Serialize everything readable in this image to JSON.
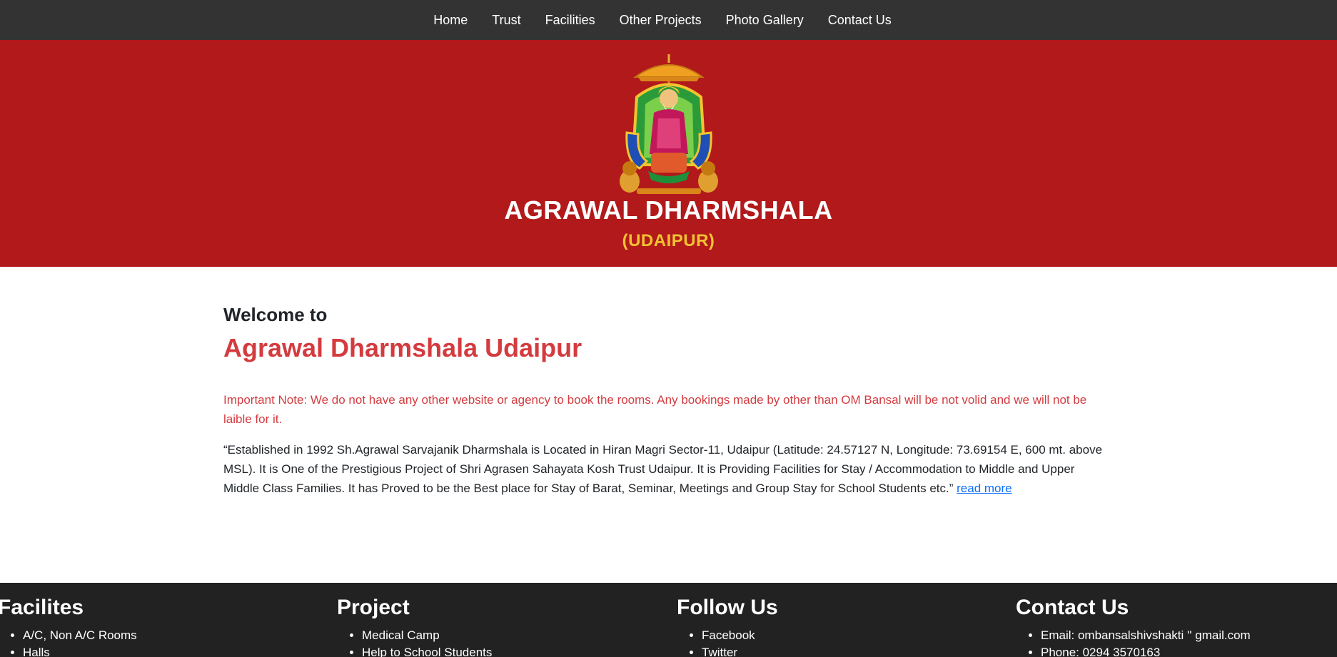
{
  "nav": {
    "items": [
      "Home",
      "Trust",
      "Facilities",
      "Other Projects",
      "Photo Gallery",
      "Contact Us"
    ]
  },
  "hero": {
    "title": "AGRAWAL DHARMSHALA",
    "subtitle": "(UDAIPUR)"
  },
  "main": {
    "welcome": "Welcome to",
    "title": "Agrawal Dharmshala Udaipur",
    "note": "Important Note: We do not have any other website or agency to book the rooms. Any bookings made by other than OM Bansal will be not volid and we will not be laible for it.",
    "intro": "“Established in 1992 Sh.Agrawal Sarvajanik Dharmshala is Located in Hiran Magri Sector-11, Udaipur (Latitude: 24.57127 N, Longitude: 73.69154 E, 600 mt. above MSL). It is One of the Prestigious Project of Shri Agrasen Sahayata Kosh Trust Udaipur. It is Providing Facilities for Stay / Accommodation to Middle and Upper Middle Class Families. It has Proved to be the Best place for Stay of Barat, Seminar, Meetings and Group Stay for School Students etc.”",
    "read_more": "read more"
  },
  "footer": {
    "columns": [
      {
        "heading": "Facilites",
        "items": [
          "A/C, Non A/C Rooms",
          "Halls"
        ]
      },
      {
        "heading": "Project",
        "items": [
          "Medical Camp",
          "Help to School Students"
        ]
      },
      {
        "heading": "Follow Us",
        "items": [
          "Facebook",
          "Twitter"
        ]
      },
      {
        "heading": "Contact Us",
        "items": [
          "Email: ombansalshivshakti '' gmail.com",
          "Phone: 0294 3570163"
        ]
      }
    ]
  },
  "colors": {
    "nav_bg": "#333333",
    "hero_bg": "#b2191b",
    "accent_red": "#d43b3f",
    "link_blue": "#0d6efd",
    "footer_bg": "#222222",
    "subtitle_gold": "#f1c232"
  }
}
